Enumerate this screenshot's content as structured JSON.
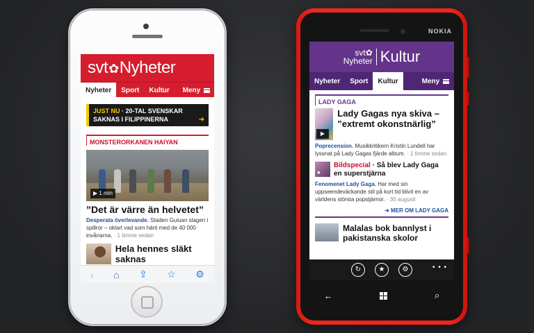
{
  "iphone": {
    "logo_svt": "svt",
    "logo_flower": "✿",
    "logo_nyheter": "Nyheter",
    "nav": [
      "Nyheter",
      "Sport",
      "Kultur",
      "Meny"
    ],
    "breaking_tag": "JUST NU",
    "breaking_text_1": "· 20-TAL SVENSKAR",
    "breaking_text_2": "SAKNAS I FILIPPINERNA",
    "section": "MONSTERORKANEN HAIYAN",
    "video_badge": "1 min",
    "headline": "”Det är värre än helvetet”",
    "kicker": "Desperata överlevande.",
    "body": "Staden Guiuan slagen i spillror – oklart vad som hänt med de 40 000 invånarna.",
    "time": "· 1 timme sedan",
    "next_headline": "Hela hennes släkt saknas",
    "toolbar": [
      "‹",
      "⌂",
      "⇪",
      "☆",
      "⚙"
    ]
  },
  "nokia": {
    "brand": "NOKIA",
    "logo_svt": "svt✿",
    "logo_nyheter": "Nyheter",
    "logo_kultur": "Kultur",
    "nav": [
      "Nyheter",
      "Sport",
      "Kultur",
      "Meny"
    ],
    "section": "LADY GAGA",
    "lead_headline": "Lady Gagas nya skiva – ”extremt okonstnärlig”",
    "lead_kicker": "Poprecension.",
    "lead_body": "Musikkritikern Kristin Lundell har lyssnat på Lady Gagas fjärde album.",
    "lead_time": "· 1 timme sedan",
    "row_red": "Bildspecial",
    "row_headline": " · Så blev Lady Gaga en superstjärna",
    "row_kicker": "Fenomenet Lady Gaga.",
    "row_body": "Har med sin uppseendeväckande stil på kort tid blivit en av världens största popstjärnor.",
    "row_time": "· 30 augusti",
    "more": "➜ MER OM LADY GAGA",
    "third_headline": "Malalas bok bannlyst i pakistanska skolor",
    "appbar": [
      "↻",
      "★",
      "⚙"
    ],
    "dots": "• • •",
    "softkeys_back": "←",
    "softkeys_search": "⌕"
  }
}
